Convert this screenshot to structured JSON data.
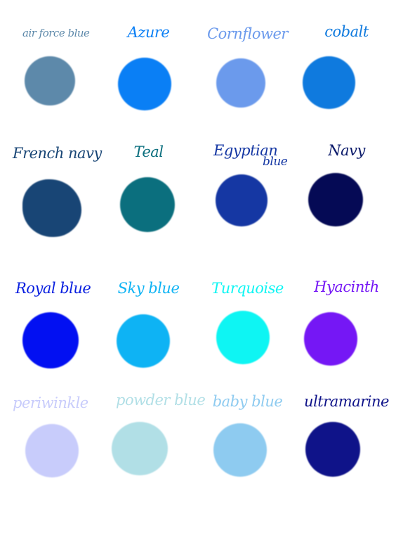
{
  "swatches": [
    {
      "label": "air force blue",
      "color": "#5d89aa",
      "text_color": "#5d89aa"
    },
    {
      "label": "Azure",
      "color": "#0a7ff5",
      "text_color": "#0a7ff5"
    },
    {
      "label": "Cornflower",
      "color": "#6b9aec",
      "text_color": "#6b9aec"
    },
    {
      "label": "cobalt",
      "color": "#0f7ade",
      "text_color": "#0f7ade"
    },
    {
      "label": "French navy",
      "color": "#184575",
      "text_color": "#184575"
    },
    {
      "label": "Teal",
      "color": "#0b6f7e",
      "text_color": "#0b6f7e"
    },
    {
      "label": "Egyptian",
      "label2": "blue",
      "color": "#1537a3",
      "text_color": "#1537a3"
    },
    {
      "label": "Navy",
      "color": "#050a55",
      "text_color": "#0b1a6a"
    },
    {
      "label": "Royal blue",
      "color": "#0210f2",
      "text_color": "#0a20e0"
    },
    {
      "label": "Sky blue",
      "color": "#0eb3f4",
      "text_color": "#0eb3f4"
    },
    {
      "label": "Turquoise",
      "color": "#0ef5f3",
      "text_color": "#0ef5f3"
    },
    {
      "label": "Hyacinth",
      "color": "#7517f5",
      "text_color": "#7517f5"
    },
    {
      "label": "periwinkle",
      "color": "#c8ccfb",
      "text_color": "#c8ccfb"
    },
    {
      "label": "powder blue",
      "color": "#b1dfe6",
      "text_color": "#b1dfe6"
    },
    {
      "label": "baby blue",
      "color": "#8ecbf0",
      "text_color": "#8ecbf0"
    },
    {
      "label": "ultramarine",
      "color": "#0f1389",
      "text_color": "#0f1389"
    }
  ]
}
